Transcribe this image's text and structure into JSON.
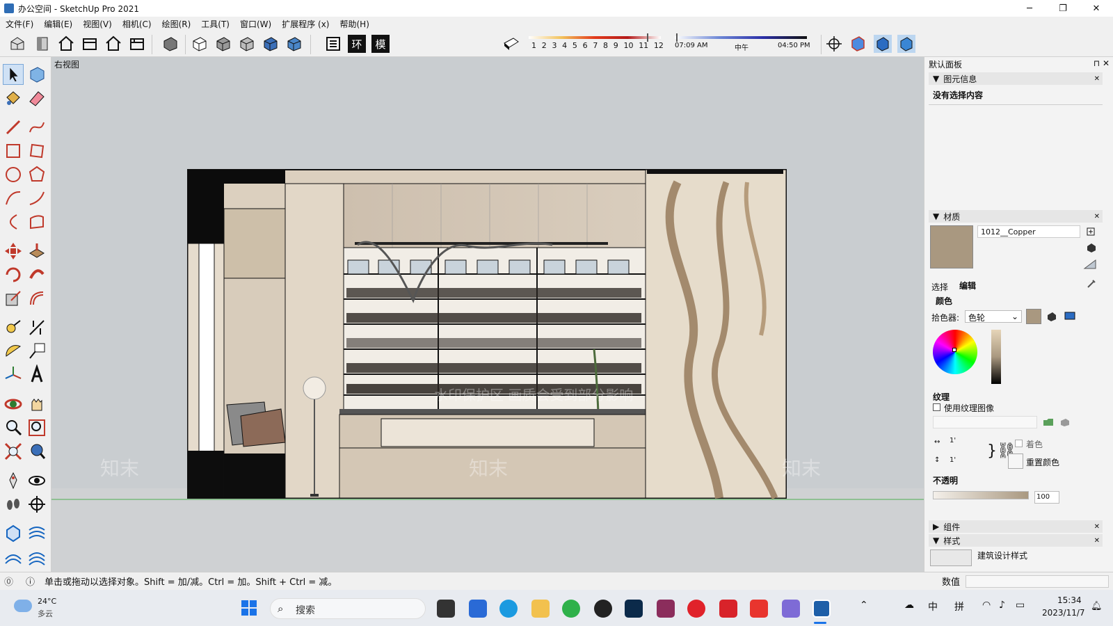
{
  "window": {
    "title": "办公空间 - SketchUp Pro 2021",
    "controls": [
      "─",
      "❐",
      "✕"
    ]
  },
  "menu": [
    "文件(F)",
    "编辑(E)",
    "视图(V)",
    "相机(C)",
    "绘图(R)",
    "工具(T)",
    "窗口(W)",
    "扩展程序 (x)",
    "帮助(H)"
  ],
  "toolbar": {
    "text_buttons": [
      "环",
      "模"
    ],
    "month_labels": [
      "1",
      "2",
      "3",
      "4",
      "5",
      "6",
      "7",
      "8",
      "9",
      "10",
      "11",
      "12"
    ],
    "time_start": "07:09 AM",
    "time_mid": "中午",
    "time_end": "04:50 PM"
  },
  "viewport": {
    "label": "右视图",
    "watermark": "知末",
    "overlay_text": "水印保护区  画质会受到部分影响"
  },
  "default_tray": {
    "title": "默认面板",
    "entity_info": {
      "title": "图元信息",
      "content": "没有选择内容"
    },
    "materials": {
      "title": "材质",
      "name": "1012__Copper",
      "swatch_color": "#a99880",
      "tabs": [
        "选择",
        "编辑"
      ],
      "color_label": "颜色",
      "picker_label": "拾色器:",
      "picker_value": "色轮",
      "texture_label": "纹理",
      "use_texture_label": "使用纹理图像",
      "dim_w": "1'",
      "dim_h": "1'",
      "colorize_label": "着色",
      "reset_color_label": "重置颜色",
      "opacity_label": "不透明",
      "opacity_value": "100"
    },
    "components": {
      "title": "组件"
    },
    "styles": {
      "title": "样式",
      "name": "建筑设计样式"
    }
  },
  "status": {
    "hint": "单击或拖动以选择对象。Shift = 加/减。Ctrl = 加。Shift + Ctrl = 减。",
    "measure_label": "数值"
  },
  "taskbar": {
    "weather_temp": "24°C",
    "weather_desc": "多云",
    "search_placeholder": "搜索",
    "ime1": "中",
    "ime2": "拼",
    "time": "15:34",
    "date": "2023/11/7"
  }
}
